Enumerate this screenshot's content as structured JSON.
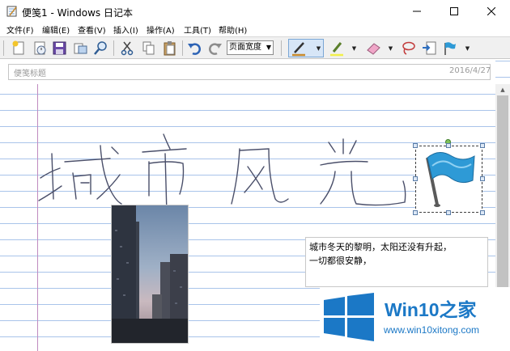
{
  "window": {
    "title": "便笺1 - Windows 日记本",
    "controls": {
      "minimize": "—",
      "maximize": "☐",
      "close": "✕"
    }
  },
  "menu": {
    "items": [
      "文件(F)",
      "编辑(E)",
      "查看(V)",
      "插入(I)",
      "操作(A)",
      "工具(T)",
      "帮助(H)"
    ]
  },
  "toolbar": {
    "zoom_value": "页面宽度",
    "pen_color": "#c98a2b",
    "highlighter_color": "#f2f04a",
    "icons": [
      "new-note-icon",
      "open-icon",
      "save-icon",
      "print-preview-icon",
      "find-icon",
      "cut-icon",
      "copy-icon",
      "paste-icon",
      "undo-icon",
      "redo-icon",
      "pen-icon",
      "highlighter-icon",
      "eraser-icon",
      "lasso-select-icon",
      "insert-space-icon",
      "flag-icon"
    ]
  },
  "note": {
    "title_placeholder": "便笺标题",
    "date": "2016/4/27",
    "textbox_lines": [
      "城市冬天的黎明，太阳还没有升起，",
      "一切都很安静，"
    ]
  },
  "watermark": {
    "brand": "Win10",
    "brand_suffix": "之家",
    "url": "www.win10xitong.com"
  },
  "colors": {
    "rule_line": "#a9c4ea",
    "margin_line": "#c08bc0",
    "flag_blue": "#2e9ad6",
    "logo_blue": "#1b78c6"
  }
}
